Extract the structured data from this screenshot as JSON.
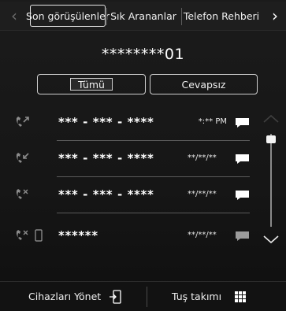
{
  "tabs": [
    {
      "label": "Son görüşülenler",
      "active": true
    },
    {
      "label": "Sık Arananlar",
      "active": false
    },
    {
      "label": "Telefon Rehberi",
      "active": false
    }
  ],
  "nav": {
    "prev_icon": "chevron-left-icon",
    "next_icon": "chevron-right-icon"
  },
  "device_name": "********01",
  "filters": {
    "all": "Tümü",
    "missed": "Cevapsız"
  },
  "calls": [
    {
      "type": "outgoing",
      "number": "*** - *** - ****",
      "time": "*:** PM",
      "has_phone_icon": false
    },
    {
      "type": "incoming",
      "number": "*** - *** - ****",
      "time": "**/**/**",
      "has_phone_icon": false
    },
    {
      "type": "missed",
      "number": "*** - *** - ****",
      "time": "**/**/**",
      "has_phone_icon": false
    },
    {
      "type": "missed",
      "number": "******",
      "time": "**/**/**",
      "has_phone_icon": true
    }
  ],
  "bottom": {
    "manage_devices": "Cihazları Yönet",
    "keypad": "Tuş takımı"
  },
  "colors": {
    "background": "#161616",
    "text": "#f2f2f2",
    "icon_muted": "#8a8a8a"
  }
}
